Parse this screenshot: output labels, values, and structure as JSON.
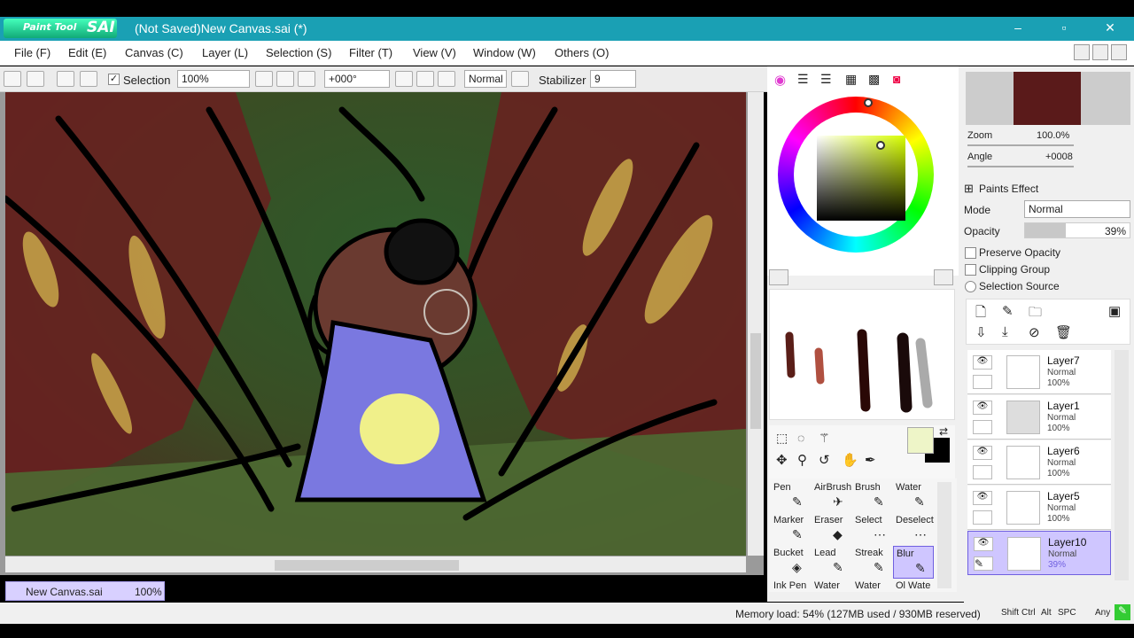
{
  "titlebar": {
    "logo_text1": "Paint Tool",
    "logo_text2": "SAI",
    "title": "(Not Saved)New Canvas.sai (*)",
    "min": "–",
    "max": "▫",
    "close": "✕"
  },
  "menu": [
    "File (F)",
    "Edit (E)",
    "Canvas (C)",
    "Layer (L)",
    "Selection (S)",
    "Filter (T)",
    "View (V)",
    "Window (W)",
    "Others (O)"
  ],
  "toolbar": {
    "selection_label": "Selection",
    "zoom": "100%",
    "angle": "+000°",
    "mode": "Normal",
    "stabilizer_label": "Stabilizer",
    "stabilizer_value": "9"
  },
  "navigator": {
    "zoom_label": "Zoom",
    "zoom_value": "100.0%",
    "angle_label": "Angle",
    "angle_value": "+0008"
  },
  "paints_effect": {
    "title": "Paints Effect",
    "mode_label": "Mode",
    "mode_value": "Normal",
    "opacity_label": "Opacity",
    "opacity_value": "39%",
    "opacity_fraction": 0.39,
    "preserve_opacity": "Preserve Opacity",
    "clipping_group": "Clipping Group",
    "selection_source": "Selection Source"
  },
  "brushes": [
    {
      "name": "Pen",
      "sub": "✎"
    },
    {
      "name": "AirBrush",
      "sub": "✈"
    },
    {
      "name": "Brush",
      "sub": "✎"
    },
    {
      "name": "Water",
      "sub": "✎"
    },
    {
      "name": "Marker",
      "sub": "✎"
    },
    {
      "name": "Eraser",
      "sub": "◆"
    },
    {
      "name": "Select",
      "sub": "⋯"
    },
    {
      "name": "Deselect",
      "sub": "⋯"
    },
    {
      "name": "Bucket",
      "sub": "◈"
    },
    {
      "name": "Lead",
      "sub": "✎"
    },
    {
      "name": "Streak",
      "sub": "✎"
    },
    {
      "name": "Blur",
      "sub": "✎"
    },
    {
      "name": "Ink Pen",
      "sub": ""
    },
    {
      "name": "Water",
      "sub": ""
    },
    {
      "name": "Water",
      "sub": ""
    },
    {
      "name": "Ol Wate",
      "sub": ""
    }
  ],
  "layers": [
    {
      "name": "Layer7",
      "mode": "Normal",
      "opacity": "100%"
    },
    {
      "name": "Layer1",
      "mode": "Normal",
      "opacity": "100%"
    },
    {
      "name": "Layer6",
      "mode": "Normal",
      "opacity": "100%"
    },
    {
      "name": "Layer5",
      "mode": "Normal",
      "opacity": "100%"
    },
    {
      "name": "Layer10",
      "mode": "Normal",
      "opacity": "39%"
    }
  ],
  "doc_tab": {
    "name": "New Canvas.sai",
    "zoom": "100%"
  },
  "status": {
    "memory": "Memory load: 54% (127MB used / 930MB reserved)",
    "keys": [
      "Shift",
      "Ctrl",
      "Alt",
      "SPC",
      "Any"
    ]
  },
  "colors": {
    "titlebar": "#1aa0b4",
    "selected_layer": "#cfc6ff",
    "primary_color": "#eef5c8",
    "secondary_color": "#000000"
  }
}
